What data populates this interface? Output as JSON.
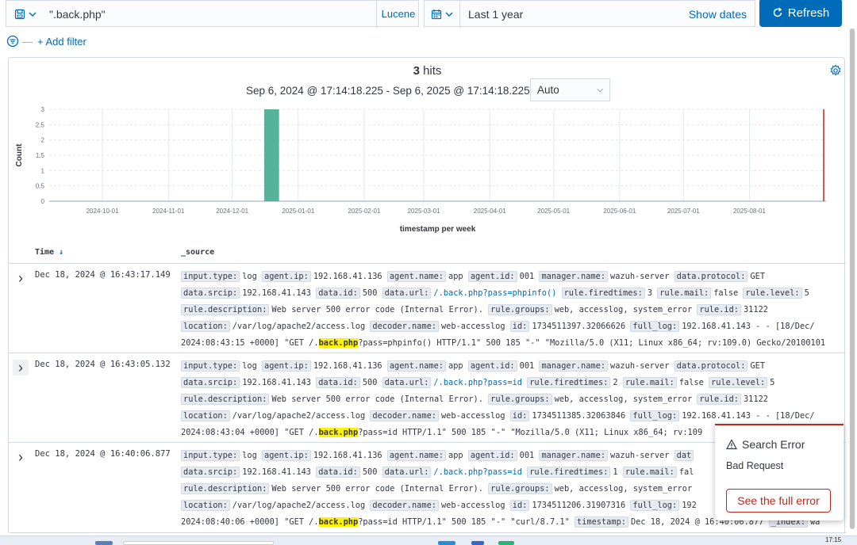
{
  "query": {
    "text": "\".back.php\"",
    "language": "Lucene"
  },
  "time": {
    "range": "Last 1 year",
    "show_dates": "Show dates"
  },
  "refresh_label": "Refresh",
  "filter": {
    "add_label": "+ Add filter"
  },
  "hits": {
    "count": "3",
    "label": "hits"
  },
  "date_range": "Sep 6, 2024 @ 17:14:18.225 - Sep 6, 2025 @ 17:14:18.225 per",
  "interval": "Auto",
  "chart_data": {
    "type": "bar",
    "xlabel": "timestamp per week",
    "ylabel": "Count",
    "ylim": [
      0,
      3
    ],
    "yticks": [
      "0",
      "0.5",
      "1",
      "1.5",
      "2",
      "2.5",
      "3"
    ],
    "xticks": [
      "2024-10-01",
      "2024-11-01",
      "2024-12-01",
      "2025-01-01",
      "2025-02-01",
      "2025-03-01",
      "2025-04-01",
      "2025-05-01",
      "2025-06-01",
      "2025-07-01",
      "2025-08-01"
    ],
    "categories": [
      "2024-12-16"
    ],
    "values": [
      3
    ],
    "bar_color": "#54b399",
    "now_marker_color": "#bd271e",
    "grid": true
  },
  "table": {
    "headers": {
      "time": "Time",
      "time_sort": "↓",
      "source": "_source"
    },
    "rows": [
      {
        "time": "Dec 18, 2024 @ 16:43:17.149",
        "lines": [
          [
            [
              "input.type:",
              "log"
            ],
            [
              "agent.ip:",
              "192.168.41.136"
            ],
            [
              "agent.name:",
              "app"
            ],
            [
              "agent.id:",
              "001"
            ],
            [
              "manager.name:",
              "wazuh-server"
            ],
            [
              "data.protocol:",
              "GET"
            ]
          ],
          [
            [
              "data.srcip:",
              "192.168.41.143"
            ],
            [
              "data.id:",
              "500"
            ],
            [
              "data.url:",
              "/.back.php?pass=phpinfo()"
            ],
            [
              "rule.firedtimes:",
              "3"
            ],
            [
              "rule.mail:",
              "false"
            ],
            [
              "rule.level:",
              "5"
            ]
          ],
          [
            [
              "rule.description:",
              "Web server 500 error code (Internal Error)."
            ],
            [
              "rule.groups:",
              "web, accesslog, system_error"
            ],
            [
              "rule.id:",
              "31122"
            ]
          ],
          [
            [
              "location:",
              "/var/log/apache2/access.log"
            ],
            [
              "decoder.name:",
              "web-accesslog"
            ],
            [
              "id:",
              "1734511397.32066626"
            ],
            [
              "full_log:",
              "192.168.41.143 - - [18/Dec/"
            ]
          ]
        ],
        "last": {
          "pre": "2024:08:43:15 +0000] \"GET /.",
          "hl": "back.php",
          "post": "?pass=phpinfo() HTTP/1.1\" 500 185 \"-\" \"Mozilla/5.0 (X11; Linux x86_64; rv:109.0) Gecko/20100101"
        }
      },
      {
        "time": "Dec 18, 2024 @ 16:43:05.132",
        "lines": [
          [
            [
              "input.type:",
              "log"
            ],
            [
              "agent.ip:",
              "192.168.41.136"
            ],
            [
              "agent.name:",
              "app"
            ],
            [
              "agent.id:",
              "001"
            ],
            [
              "manager.name:",
              "wazuh-server"
            ],
            [
              "data.protocol:",
              "GET"
            ]
          ],
          [
            [
              "data.srcip:",
              "192.168.41.143"
            ],
            [
              "data.id:",
              "500"
            ],
            [
              "data.url:",
              "/.back.php?pass=id"
            ],
            [
              "rule.firedtimes:",
              "2"
            ],
            [
              "rule.mail:",
              "false"
            ],
            [
              "rule.level:",
              "5"
            ]
          ],
          [
            [
              "rule.description:",
              "Web server 500 error code (Internal Error)."
            ],
            [
              "rule.groups:",
              "web, accesslog, system_error"
            ],
            [
              "rule.id:",
              "31122"
            ]
          ],
          [
            [
              "location:",
              "/var/log/apache2/access.log"
            ],
            [
              "decoder.name:",
              "web-accesslog"
            ],
            [
              "id:",
              "1734511385.32063846"
            ],
            [
              "full_log:",
              "192.168.41.143 - - [18/Dec/"
            ]
          ]
        ],
        "last": {
          "pre": "2024:08:43:04 +0000] \"GET /.",
          "hl": "back.php",
          "post": "?pass=id HTTP/1.1\" 500 185 \"-\" \"Mozilla/5.0 (X11; Linux x86_64; rv:109"
        }
      },
      {
        "time": "Dec 18, 2024 @ 16:40:06.877",
        "lines": [
          [
            [
              "input.type:",
              "log"
            ],
            [
              "agent.ip:",
              "192.168.41.136"
            ],
            [
              "agent.name:",
              "app"
            ],
            [
              "agent.id:",
              "001"
            ],
            [
              "manager.name:",
              "wazuh-server"
            ],
            [
              "dat",
              ""
            ]
          ],
          [
            [
              "data.srcip:",
              "192.168.41.143"
            ],
            [
              "data.id:",
              "500"
            ],
            [
              "data.url:",
              "/.back.php?pass=id"
            ],
            [
              "rule.firedtimes:",
              "1"
            ],
            [
              "rule.mail:",
              "fal"
            ]
          ],
          [
            [
              "rule.description:",
              "Web server 500 error code (Internal Error)."
            ],
            [
              "rule.groups:",
              "web, accesslog, system_error"
            ]
          ],
          [
            [
              "location:",
              "/var/log/apache2/access.log"
            ],
            [
              "decoder.name:",
              "web-accesslog"
            ],
            [
              "id:",
              "1734511206.31907316"
            ],
            [
              "full_log:",
              "192"
            ]
          ]
        ],
        "last": {
          "pre": "2024:08:40:06 +0000] \"GET /.",
          "hl": "back.php",
          "post": "?pass=id HTTP/1.1\" 500 185 \"-\" \"curl/8.7.1\"",
          "extra": [
            [
              "timestamp:",
              "Dec 18, 2024 @ 16:40:06.877"
            ],
            [
              "_index:",
              "wa"
            ]
          ]
        }
      }
    ]
  },
  "toast": {
    "title": "Search Error",
    "body": "Bad Request",
    "button": "See the full error"
  },
  "taskbar": {
    "clock": "17:15"
  }
}
